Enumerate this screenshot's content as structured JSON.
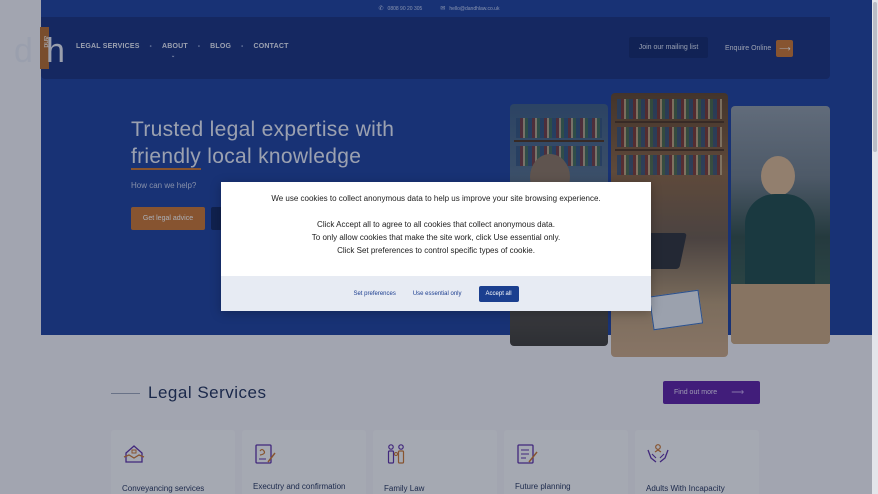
{
  "topbar": {
    "phone": "0808 90 20 305",
    "email": "hello@dandhlaw.co.uk"
  },
  "logo": {
    "left_letter": "d",
    "middle": "and",
    "right_letter": "h"
  },
  "nav": {
    "items": [
      {
        "label": "LEGAL SERVICES"
      },
      {
        "label": "ABOUT"
      },
      {
        "label": "BLOG"
      },
      {
        "label": "CONTACT"
      }
    ],
    "separator": "•",
    "mailing_list": "Join our mailing list",
    "enquire": "Enquire Online"
  },
  "hero": {
    "title_line1": "Trusted legal expertise with",
    "title_word_underlined": "friendly",
    "title_line2_rest": " local knowledge",
    "question": "How can we help?",
    "primary_button": "Get legal advice"
  },
  "cookie": {
    "line1": "We use cookies to collect anonymous data to help us improve your site browsing experience.",
    "line2": "Click Accept all to agree to all cookies that collect anonymous data.",
    "line3": "To only allow cookies that make the site work, click Use essential only.",
    "line4": "Click Set preferences to control specific types of cookie.",
    "set_preferences": "Set preferences",
    "use_essential": "Use essential only",
    "accept_all": "Accept all"
  },
  "services": {
    "title": "Legal Services",
    "find_out_more": "Find out more",
    "cards": [
      {
        "label": "Conveyancing services",
        "icon": "house-handshake-icon"
      },
      {
        "label": "Executry and confirmation",
        "icon": "document-pen-icon"
      },
      {
        "label": "Family Law",
        "icon": "family-icon"
      },
      {
        "label": "Future planning",
        "icon": "checklist-icon"
      },
      {
        "label": "Adults With Incapacity",
        "icon": "care-hands-icon"
      }
    ]
  },
  "colors": {
    "brand_blue": "#1b3f9c",
    "nav_blue": "#172f7c",
    "accent_orange": "#c8752f",
    "purple_button": "#5b1fa3",
    "icon_purple": "#5b2ea6",
    "icon_orange": "#c8752f"
  }
}
